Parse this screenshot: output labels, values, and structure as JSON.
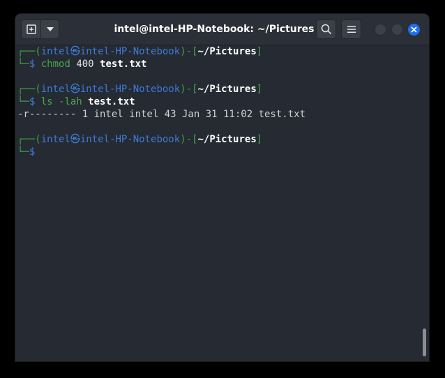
{
  "window": {
    "title": "intel@intel-HP-Notebook: ~/Pictures"
  },
  "headerbar": {
    "new_tab_icon": "new-tab-icon",
    "dropdown_icon": "chevron-down-icon",
    "search_icon": "search-icon",
    "menu_icon": "hamburger-menu-icon",
    "close_icon": "close-icon"
  },
  "colors": {
    "prompt_green": "#3fa73f",
    "prompt_blue": "#3d7bd6",
    "close_blue": "#1f6feb",
    "background": "#252a33"
  },
  "prompt": {
    "open": "┌──(",
    "user": "intel",
    "at_glyph": "㉿",
    "host": "intel-HP-Notebook",
    "mid": ")-[",
    "path": "~/Pictures",
    "close": "]",
    "second_line": "└─",
    "dollar": "$"
  },
  "terminal": {
    "command1": {
      "name": "chmod",
      "args": " 400 ",
      "file": "test.txt"
    },
    "command2": {
      "name": "ls",
      "args": " -lah ",
      "file": "test.txt"
    },
    "output_line": "-r-------- 1 intel intel 43 Jan 31 11:02 test.txt"
  }
}
